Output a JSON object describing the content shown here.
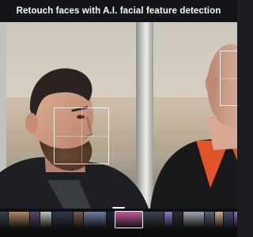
{
  "header": {
    "title": "Retouch faces with A.I. facial feature detection"
  },
  "photo": {
    "subjects": [
      {
        "name": "man with beard, dark jacket"
      },
      {
        "name": "person with shaved head, orange collar"
      }
    ],
    "detected_faces": 2
  },
  "filmstrip": {
    "thumbnail_colors": [
      "#3a3f55",
      "#b08a60",
      "#5a4a70",
      "#c7c2b8",
      "#2f3a4c",
      "#7a5a48",
      "#6d7fa0",
      "#1f2631",
      "#c45a9a",
      "#3b4450",
      "#8a7dc9",
      "#2a2f38",
      "#a0a8b5",
      "#546070",
      "#d2b28a",
      "#47516a",
      "#9b6bb5",
      "#5e6d7f",
      "#cfc5b9",
      "#3c4a5a",
      "#7f8fa3",
      "#b7b0a2",
      "#4b3c5e"
    ],
    "selected_index": 8
  },
  "colors": {
    "topbar": "#121418",
    "accent": "#ffffff"
  }
}
